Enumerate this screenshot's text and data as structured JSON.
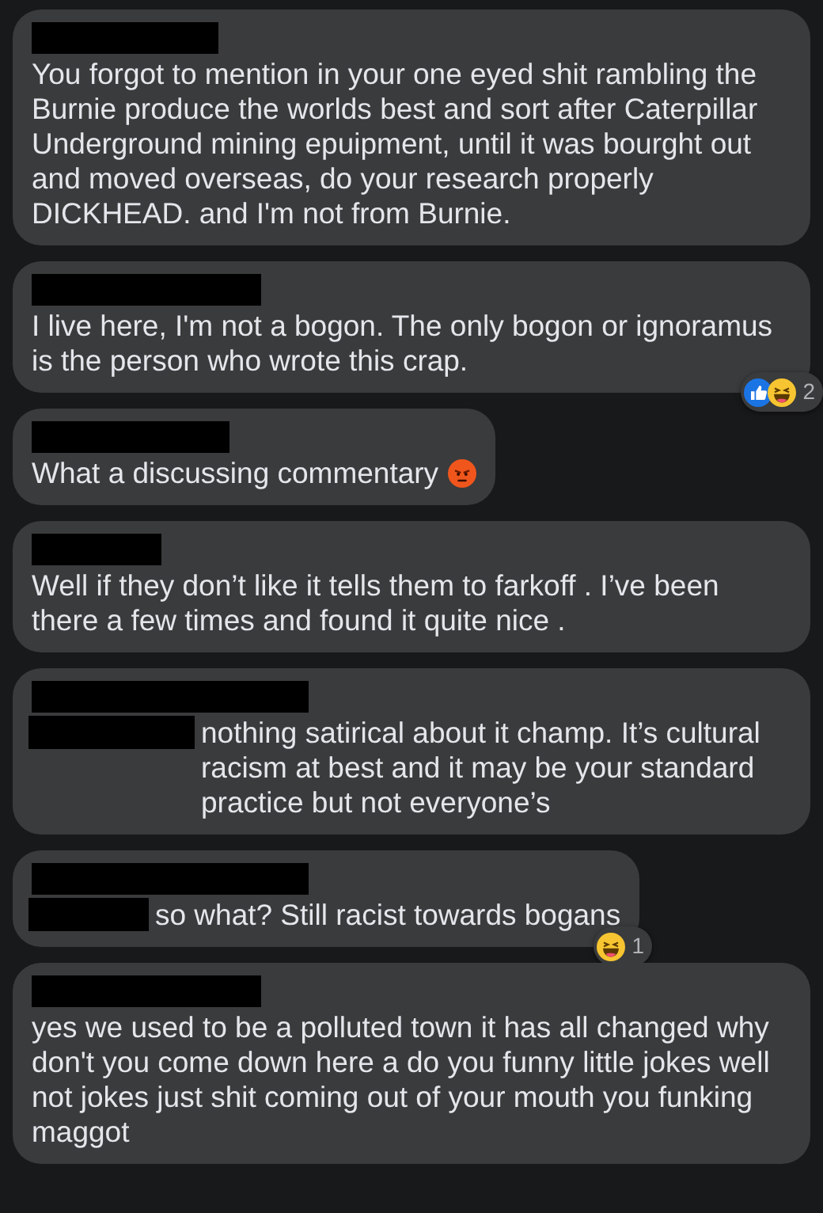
{
  "comments": [
    {
      "text": "You forgot to mention in your one eyed shit rambling the Burnie produce the worlds best and sort after Caterpillar Underground mining epuipment, until it was bourght out and moved overseas, do your research properly DICKHEAD. and I'm not from Burnie.",
      "mention": false
    },
    {
      "text": "I live here, I'm not a bogon. The only bogon or ignoramus is the person who wrote this crap.",
      "mention": false,
      "reactions": {
        "items": [
          {
            "kind": "like"
          },
          {
            "kind": "haha"
          }
        ],
        "count": "2"
      }
    },
    {
      "text": "What a discussing commentary",
      "mention": false,
      "emoji": {
        "kind": "angry"
      }
    },
    {
      "text": "Well if they don’t like it tells them to farkoff . I’ve been there a few times and found it quite nice .",
      "mention": false
    },
    {
      "text": "nothing satirical about it champ. It’s cultural racism at best and it may be your standard practice but not everyone’s",
      "mention": true
    },
    {
      "text": "so what? Still racist towards bogans",
      "mention": true,
      "reactions": {
        "items": [
          {
            "kind": "haha"
          }
        ],
        "count": "1"
      }
    },
    {
      "text": "yes we used to be a polluted town it has all changed why don't you come down here a do you funny little jokes well not jokes just shit coming out of your mouth you funking maggot",
      "mention": false
    }
  ]
}
